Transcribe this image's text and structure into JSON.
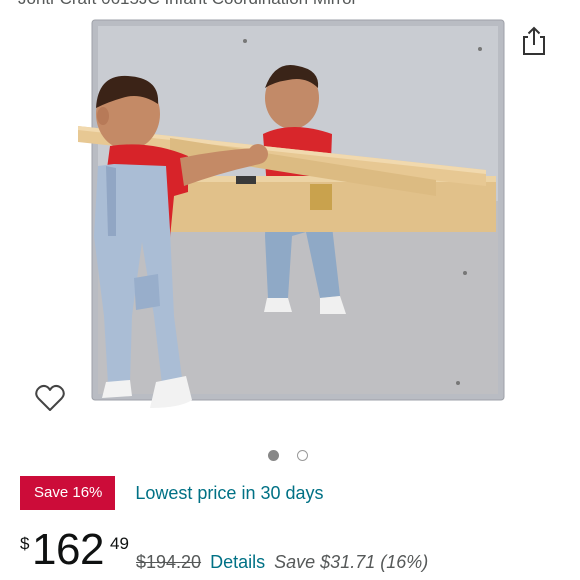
{
  "product": {
    "title": "Jonti-Craft 0615JC Infant Coordination Mirror"
  },
  "icons": {
    "share": "share-icon",
    "wishlist": "heart-outline-icon"
  },
  "image_carousel": {
    "image_count": 2,
    "active_index": 0,
    "hero_description_icon": "product-photo"
  },
  "deal": {
    "badge_label": "Save 16%",
    "badge_color": "#cc0c39",
    "text": "Lowest price in 30 days",
    "text_color": "#007185"
  },
  "price": {
    "currency_symbol": "$",
    "whole": "162",
    "fraction": "49",
    "list_price": "$194.20",
    "details_label": "Details",
    "savings_text": "Save $31.71 (16%)"
  }
}
